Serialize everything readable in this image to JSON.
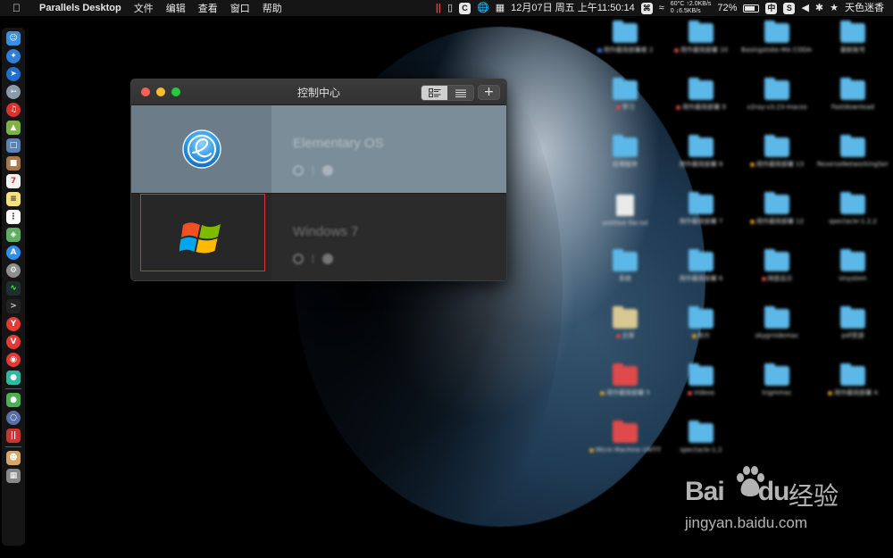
{
  "menubar": {
    "app_name": "Parallels Desktop",
    "menus": [
      "文件",
      "编辑",
      "查看",
      "窗口",
      "帮助"
    ],
    "date_time": "12月07日 周五 上午11:50:14",
    "net_up": "↑2.0KB/s",
    "net_down": "↓6.5KB/s",
    "cpu_temp": "60°C",
    "fan": "0",
    "battery_percent": "72%",
    "battery_level": 0.72,
    "input_method": "中",
    "user_name": "天色迷香"
  },
  "window": {
    "title": "控制中心",
    "add_label": "+",
    "vms": [
      {
        "name": "Elementary OS",
        "icon": "elementary-os-icon",
        "selected": true
      },
      {
        "name": "Windows 7",
        "icon": "windows-logo-icon",
        "selected": false
      }
    ]
  },
  "desktop": {
    "items": [
      {
        "label": "用作最简部署者 2",
        "type": "folder",
        "tag": "#3b82f6"
      },
      {
        "label": "用作最简部署 10",
        "type": "folder",
        "tag": "#e04a4a"
      },
      {
        "label": "Basingstoke-MA CODA-GOG",
        "type": "folder",
        "tag": ""
      },
      {
        "label": "最新账号",
        "type": "folder",
        "tag": ""
      },
      {
        "label": "学习",
        "type": "folder",
        "tag": "#e04a4a"
      },
      {
        "label": "用作最简部署 9",
        "type": "folder",
        "tag": "#e04a4a"
      },
      {
        "label": "v2ray-v3.23-macos",
        "type": "folder",
        "tag": ""
      },
      {
        "label": "Fastdownload",
        "type": "folder",
        "tag": ""
      },
      {
        "label": "应用程序",
        "type": "folder",
        "tag": ""
      },
      {
        "label": "用作最简部署 8",
        "type": "folder",
        "tag": ""
      },
      {
        "label": "用作最简部署 13",
        "type": "folder",
        "tag": "#e0a030"
      },
      {
        "label": "ReverseNetworkingServer_1.2.0",
        "type": "folder",
        "tag": ""
      },
      {
        "label": "untitled file.txt",
        "type": "doc",
        "tag": ""
      },
      {
        "label": "用作最简部署 7",
        "type": "folder",
        "tag": ""
      },
      {
        "label": "用作最简部署 12",
        "type": "folder",
        "tag": "#e0a030"
      },
      {
        "label": "spectacle-1.2.2",
        "type": "folder",
        "tag": ""
      },
      {
        "label": "系统",
        "type": "folder",
        "tag": ""
      },
      {
        "label": "用作最简部署 6",
        "type": "folder",
        "tag": ""
      },
      {
        "label": "网盘显示",
        "type": "folder",
        "tag": "#e04a4a"
      },
      {
        "label": "Unystem",
        "type": "folder",
        "tag": ""
      },
      {
        "label": "文章",
        "type": "doc",
        "tag": "#e04a4a"
      },
      {
        "label": "影片",
        "type": "folder",
        "tag": "#e0a030"
      },
      {
        "label": "skygrnidemac",
        "type": "folder",
        "tag": ""
      },
      {
        "label": "pdf资源",
        "type": "folder",
        "tag": ""
      },
      {
        "label": "用作最简部署 5",
        "type": "folder",
        "tag": "#e0a030"
      },
      {
        "label": "Videos",
        "type": "folder",
        "tag": "#e04a4a"
      },
      {
        "label": "tngmmac",
        "type": "folder",
        "tag": ""
      },
      {
        "label": "用作最简部署 4",
        "type": "folder",
        "tag": "#e0a030"
      },
      {
        "label": "Micro Machine UNTITLED",
        "type": "folder",
        "tag": "#e0a030"
      },
      {
        "label": "spectacle-1.2",
        "type": "folder",
        "tag": ""
      }
    ]
  },
  "watermark": {
    "baidu": "Bai",
    "baidu_tail": "du",
    "cn": "经验",
    "url": "jingyan.baidu.com"
  },
  "colors": {
    "selected_row": "#7b8d99",
    "highlight_border": "#e03030",
    "close": "#fc5f57",
    "minimize": "#fdbc2e",
    "maximize": "#28c840"
  }
}
